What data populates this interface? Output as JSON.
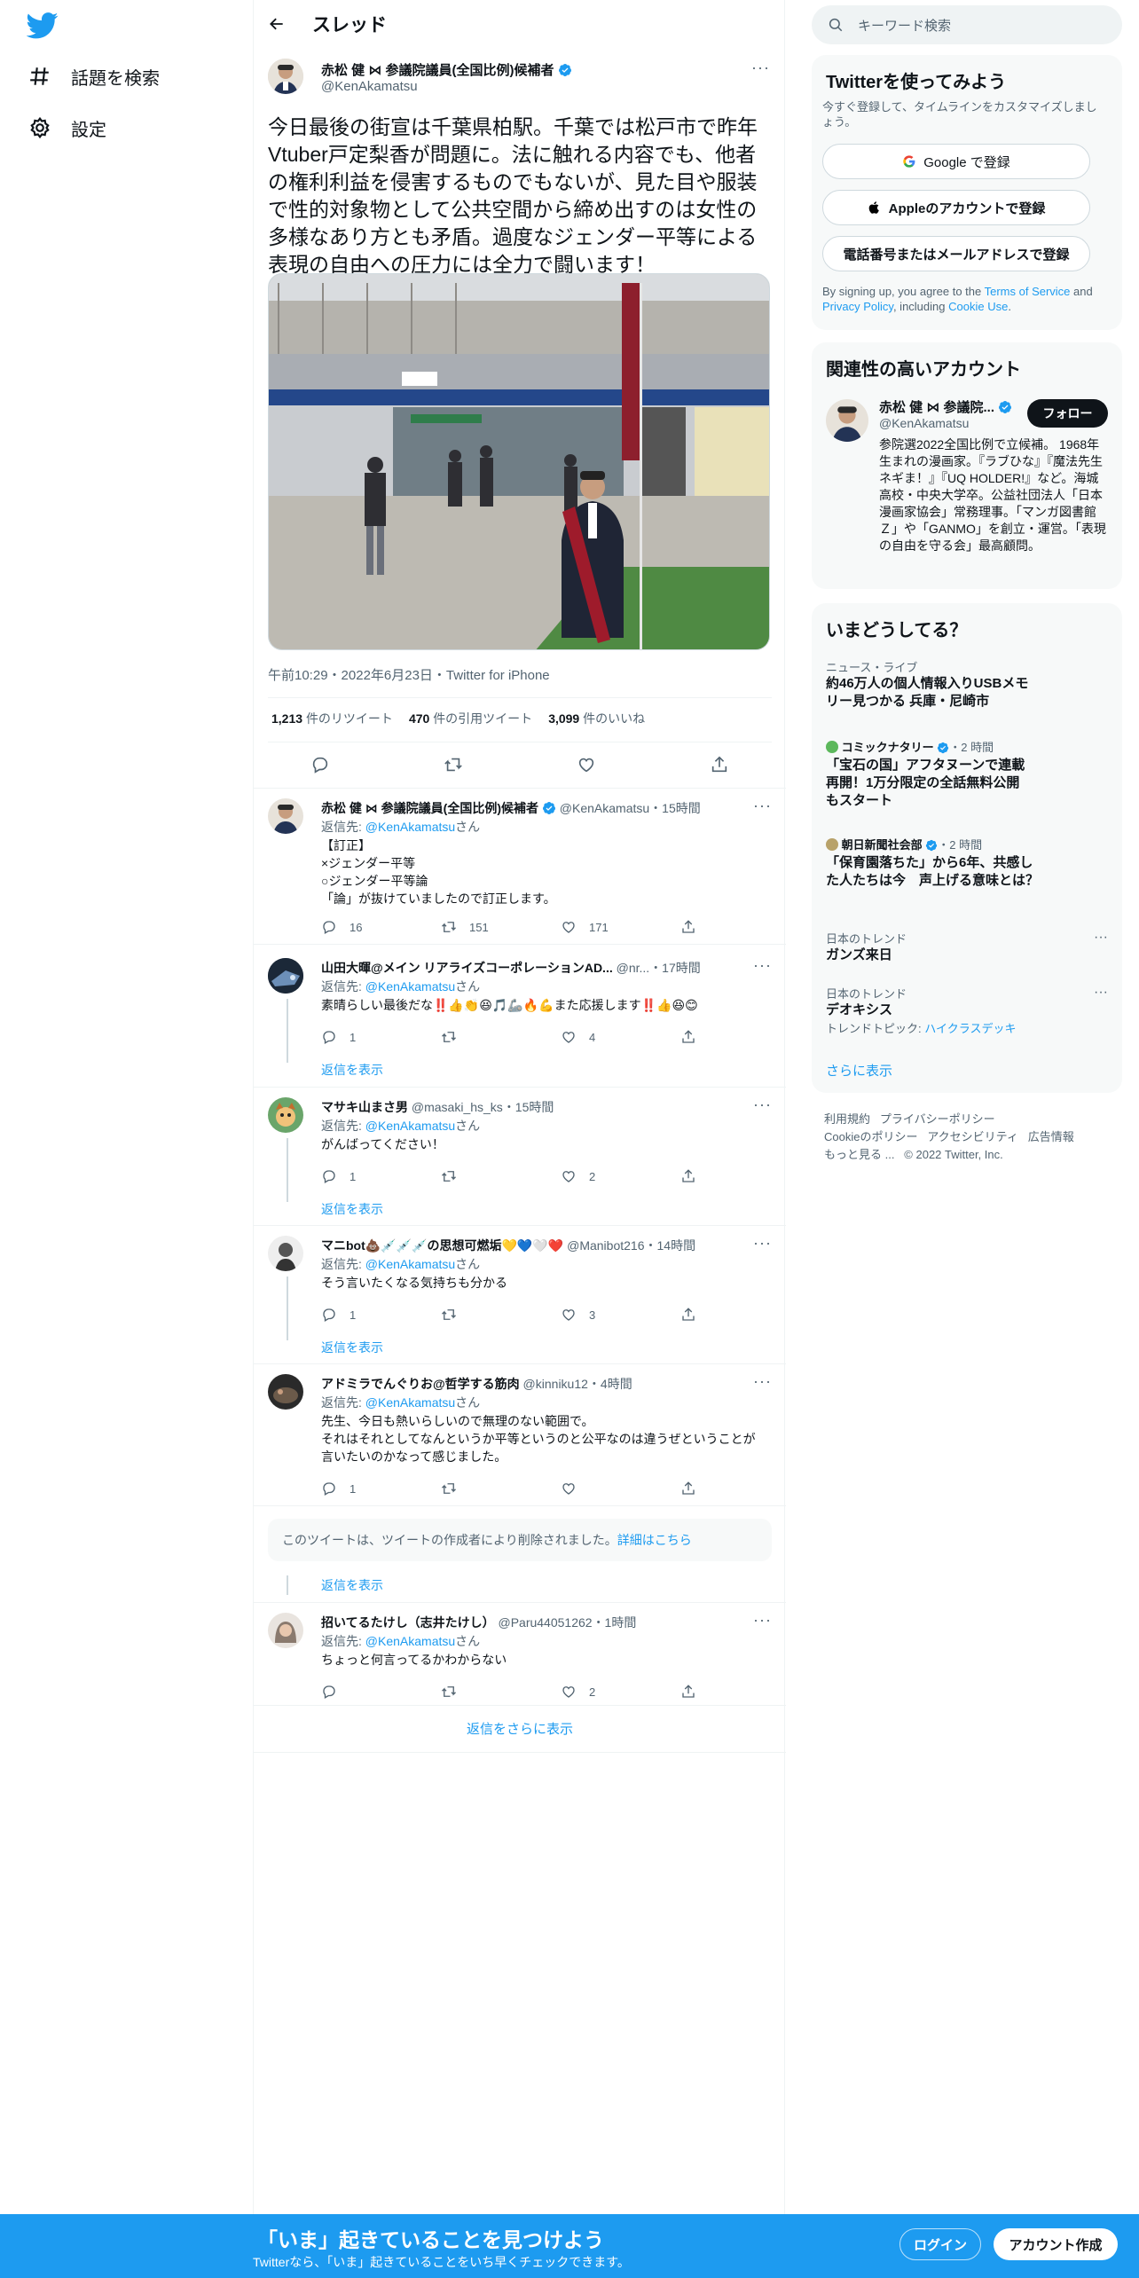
{
  "sidebar": {
    "explore_label": "話題を検索",
    "settings_label": "設定"
  },
  "header": {
    "title": "スレッド"
  },
  "main_tweet": {
    "name": "赤松 健 ⋈ 参議院議員(全国比例)候補者",
    "handle": "@KenAkamatsu",
    "text": "今日最後の街宣は千葉県柏駅。千葉では松戸市で昨年Vtuber戸定梨香が問題に。法に触れる内容でも、他者の権利利益を侵害するものでもないが、見た目や服装で性的対象物として公共空間から締め出すのは女性の多様なあり方とも矛盾。過度なジェンダー平等による表現の自由への圧力には全力で闘います！",
    "meta": "午前10:29・2022年6月23日・Twitter for iPhone",
    "retweets_count": "1,213",
    "retweets_label": "件のリツイート",
    "quotes_count": "470",
    "quotes_label": "件の引用ツイート",
    "likes_count": "3,099",
    "likes_label": "件のいいね"
  },
  "replies": [
    {
      "name": "赤松 健 ⋈ 参議院議員(全国比例)候補者",
      "handle": "@KenAkamatsu",
      "time": "・15時間",
      "reply_to_prefix": "返信先: ",
      "reply_to": "@KenAkamatsu",
      "reply_to_suffix": "さん",
      "lines": [
        "【訂正】",
        "×ジェンダー平等",
        "○ジェンダー平等論",
        "「論」が抜けていましたので訂正します。"
      ],
      "replies": "16",
      "retweets": "151",
      "likes": "171"
    },
    {
      "name": "山田大暉@メイン リアライズコーポレーションAD...",
      "handle": "@nr...",
      "time": "・17時間",
      "reply_to_prefix": "返信先: ",
      "reply_to": "@KenAkamatsu",
      "reply_to_suffix": "さん",
      "lines": [
        "素晴らしい最後だな‼️👍👏😆🎵🦾🔥💪また応援します‼️👍😆😊"
      ],
      "replies": "1",
      "retweets": "",
      "likes": "4",
      "show_replies": "返信を表示"
    },
    {
      "name": "マサキ山まさ男",
      "handle": "@masaki_hs_ks",
      "time": "・15時間",
      "reply_to_prefix": "返信先: ",
      "reply_to": "@KenAkamatsu",
      "reply_to_suffix": "さん",
      "lines": [
        "がんばってください！"
      ],
      "replies": "1",
      "retweets": "",
      "likes": "2",
      "show_replies": "返信を表示"
    },
    {
      "name": "マニbot💩💉💉💉の思想可燃垢💛💙🤍❤️",
      "handle": "@Manibot216",
      "time": "・14時間",
      "reply_to_prefix": "返信先: ",
      "reply_to": "@KenAkamatsu",
      "reply_to_suffix": "さん",
      "lines": [
        "そう言いたくなる気持ちも分かる"
      ],
      "replies": "1",
      "retweets": "",
      "likes": "3",
      "show_replies": "返信を表示"
    },
    {
      "name": "アドミラでんぐりお@哲学する筋肉",
      "handle": "@kinniku12",
      "time": "・4時間",
      "reply_to_prefix": "返信先: ",
      "reply_to": "@KenAkamatsu",
      "reply_to_suffix": "さん",
      "lines": [
        "先生、今日も熱いらしいので無理のない範囲で。",
        "それはそれとしてなんというか平等というのと公平なのは違うぜということが言いたいのかなって感じました。"
      ],
      "replies": "1",
      "retweets": "",
      "likes": ""
    },
    {
      "name": "招いてるたけし（志井たけし）",
      "handle": "@Paru44051262",
      "time": "・1時間",
      "reply_to_prefix": "返信先: ",
      "reply_to": "@KenAkamatsu",
      "reply_to_suffix": "さん",
      "lines": [
        "ちょっと何言ってるかわからない"
      ],
      "replies": "",
      "retweets": "",
      "likes": "2"
    }
  ],
  "deleted_notice": {
    "text": "このツイートは、ツイートの作成者により削除されました。",
    "link": "詳細はこちら",
    "show_replies": "返信を表示"
  },
  "show_more_replies": "返信をさらに表示",
  "search": {
    "placeholder": "キーワード検索"
  },
  "signup_card": {
    "title": "Twitterを使ってみよう",
    "subtitle": "今すぐ登録して、タイムラインをカスタマイズしましょう。",
    "google": "Google で登録",
    "apple": "Appleのアカウントで登録",
    "phone": "電話番号またはメールアドレスで登録",
    "legal_1": "By signing up, you agree to the ",
    "terms": "Terms of Service",
    "legal_2": " and ",
    "privacy": "Privacy Policy",
    "legal_3": ", including ",
    "cookie": "Cookie Use",
    "legal_4": "."
  },
  "relevant": {
    "title": "関連性の高いアカウント",
    "name": "赤松 健 ⋈ 参議院...",
    "handle": "@KenAkamatsu",
    "follow": "フォロー",
    "bio": "参院選2022全国比例で立候補。 1968年生まれの漫画家。『ラブひな』『魔法先生ネギま！』『UQ HOLDER!』など。海城高校・中央大学卒。公益社団法人「日本漫画家協会」常務理事。「マンガ図書館Ｚ」や「GANMO」を創立・運営。「表現の自由を守る会」最高顧問。"
  },
  "trends": {
    "title": "いまどうしてる？",
    "items": [
      {
        "category": "ニュース・ライブ",
        "title": "約46万人の個人情報入りUSBメモリー見つかる 兵庫・尼崎市"
      },
      {
        "source": "コミックナタリー",
        "time": "・2 時間",
        "title": "「宝石の国」アフタヌーンで連載再開！1万分限定の全話無料公開もスタート"
      },
      {
        "source": "朝日新聞社会部",
        "time": "・2 時間",
        "title": "「保育園落ちた」から6年、共感した人たちは今　声上げる意味とは？"
      },
      {
        "category": "日本のトレンド",
        "title": "ガンズ来日"
      },
      {
        "category": "日本のトレンド",
        "title": "デオキシス",
        "topic_prefix": "トレンドトピック: ",
        "topic": "ハイクラスデッキ"
      }
    ],
    "more": "さらに表示"
  },
  "footer": {
    "links": [
      "利用規約",
      "プライバシーポリシー",
      "Cookieのポリシー",
      "アクセシビリティ",
      "広告情報",
      "もっと見る ..."
    ],
    "copyright": "© 2022 Twitter, Inc."
  },
  "bottom_bar": {
    "title": "「いま」起きていることを見つけよう",
    "subtitle": "Twitterなら、「いま」起きていることをいち早くチェックできます。",
    "login": "ログイン",
    "signup": "アカウント作成"
  },
  "colors": {
    "accent": "#1d9bf0",
    "text": "#0f1419",
    "muted": "#536471",
    "border": "#eff3f4"
  }
}
